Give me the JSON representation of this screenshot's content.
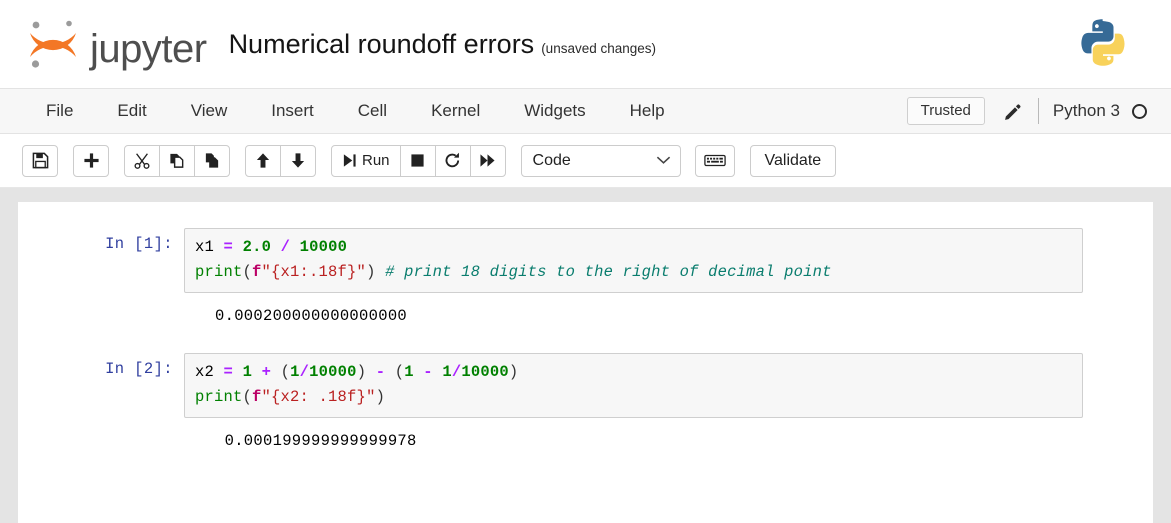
{
  "header": {
    "logo_text": "jupyter",
    "logo_icon": "jupyter-logo-icon",
    "notebook_title": "Numerical roundoff errors",
    "save_state": "(unsaved changes)",
    "kernel_logo_icon": "python-logo-icon"
  },
  "menubar": {
    "items": [
      {
        "label": "File"
      },
      {
        "label": "Edit"
      },
      {
        "label": "View"
      },
      {
        "label": "Insert"
      },
      {
        "label": "Cell"
      },
      {
        "label": "Kernel"
      },
      {
        "label": "Widgets"
      },
      {
        "label": "Help"
      }
    ],
    "trusted_label": "Trusted",
    "edit_icon": "pencil-icon",
    "kernel_label": "Python 3",
    "kernel_status_icon": "kernel-idle-circle-icon"
  },
  "toolbar": {
    "buttons": [
      {
        "name": "save-button",
        "icon": "floppy-disk-icon",
        "label": ""
      },
      {
        "name": "insert-cell-below-button",
        "icon": "plus-icon",
        "label": ""
      },
      {
        "name": "cut-cell-button",
        "icon": "scissors-icon",
        "label": ""
      },
      {
        "name": "copy-cell-button",
        "icon": "copy-icon",
        "label": ""
      },
      {
        "name": "paste-cell-button",
        "icon": "paste-icon",
        "label": ""
      },
      {
        "name": "move-cell-up-button",
        "icon": "arrow-up-icon",
        "label": ""
      },
      {
        "name": "move-cell-down-button",
        "icon": "arrow-down-icon",
        "label": ""
      },
      {
        "name": "run-button",
        "icon": "run-icon",
        "label": "Run"
      },
      {
        "name": "interrupt-kernel-button",
        "icon": "stop-square-icon",
        "label": ""
      },
      {
        "name": "restart-kernel-button",
        "icon": "restart-circular-arrow-icon",
        "label": ""
      },
      {
        "name": "restart-and-run-all-button",
        "icon": "fast-forward-icon",
        "label": ""
      }
    ],
    "cell_type_value": "Code",
    "cell_type_caret_icon": "chevron-down-icon",
    "keyboard_shortcut_icon": "keyboard-icon",
    "validate_label": "Validate"
  },
  "notebook": {
    "cells": [
      {
        "prompt": "In [1]:",
        "lines": [
          [
            {
              "t": "x1",
              "c": "tok-name"
            },
            {
              "t": " ",
              "c": "tok-plain"
            },
            {
              "t": "=",
              "c": "tok-op"
            },
            {
              "t": " ",
              "c": "tok-plain"
            },
            {
              "t": "2.0",
              "c": "tok-num"
            },
            {
              "t": " ",
              "c": "tok-plain"
            },
            {
              "t": "/",
              "c": "tok-op"
            },
            {
              "t": " ",
              "c": "tok-plain"
            },
            {
              "t": "10000",
              "c": "tok-num"
            }
          ],
          [
            {
              "t": "print",
              "c": "tok-fn"
            },
            {
              "t": "(",
              "c": "tok-paren"
            },
            {
              "t": "f",
              "c": "tok-pref"
            },
            {
              "t": "\"{x1:.18f}\"",
              "c": "tok-str"
            },
            {
              "t": ")",
              "c": "tok-paren"
            },
            {
              "t": " ",
              "c": "tok-plain"
            },
            {
              "t": "# print 18 digits to the right of decimal point",
              "c": "tok-cmt"
            }
          ]
        ],
        "output": "0.000200000000000000"
      },
      {
        "prompt": "In [2]:",
        "lines": [
          [
            {
              "t": "x2",
              "c": "tok-name"
            },
            {
              "t": " ",
              "c": "tok-plain"
            },
            {
              "t": "=",
              "c": "tok-op"
            },
            {
              "t": " ",
              "c": "tok-plain"
            },
            {
              "t": "1",
              "c": "tok-num"
            },
            {
              "t": " ",
              "c": "tok-plain"
            },
            {
              "t": "+",
              "c": "tok-op"
            },
            {
              "t": " ",
              "c": "tok-plain"
            },
            {
              "t": "(",
              "c": "tok-paren"
            },
            {
              "t": "1",
              "c": "tok-num"
            },
            {
              "t": "/",
              "c": "tok-op"
            },
            {
              "t": "10000",
              "c": "tok-num"
            },
            {
              "t": ")",
              "c": "tok-paren"
            },
            {
              "t": " ",
              "c": "tok-plain"
            },
            {
              "t": "-",
              "c": "tok-op"
            },
            {
              "t": " ",
              "c": "tok-plain"
            },
            {
              "t": "(",
              "c": "tok-paren"
            },
            {
              "t": "1",
              "c": "tok-num"
            },
            {
              "t": " ",
              "c": "tok-plain"
            },
            {
              "t": "-",
              "c": "tok-op"
            },
            {
              "t": " ",
              "c": "tok-plain"
            },
            {
              "t": "1",
              "c": "tok-num"
            },
            {
              "t": "/",
              "c": "tok-op"
            },
            {
              "t": "10000",
              "c": "tok-num"
            },
            {
              "t": ")",
              "c": "tok-paren"
            }
          ],
          [
            {
              "t": "print",
              "c": "tok-fn"
            },
            {
              "t": "(",
              "c": "tok-paren"
            },
            {
              "t": "f",
              "c": "tok-pref"
            },
            {
              "t": "\"{x2: .18f}\"",
              "c": "tok-str"
            },
            {
              "t": ")",
              "c": "tok-paren"
            }
          ]
        ],
        "output": " 0.000199999999999978"
      }
    ]
  }
}
